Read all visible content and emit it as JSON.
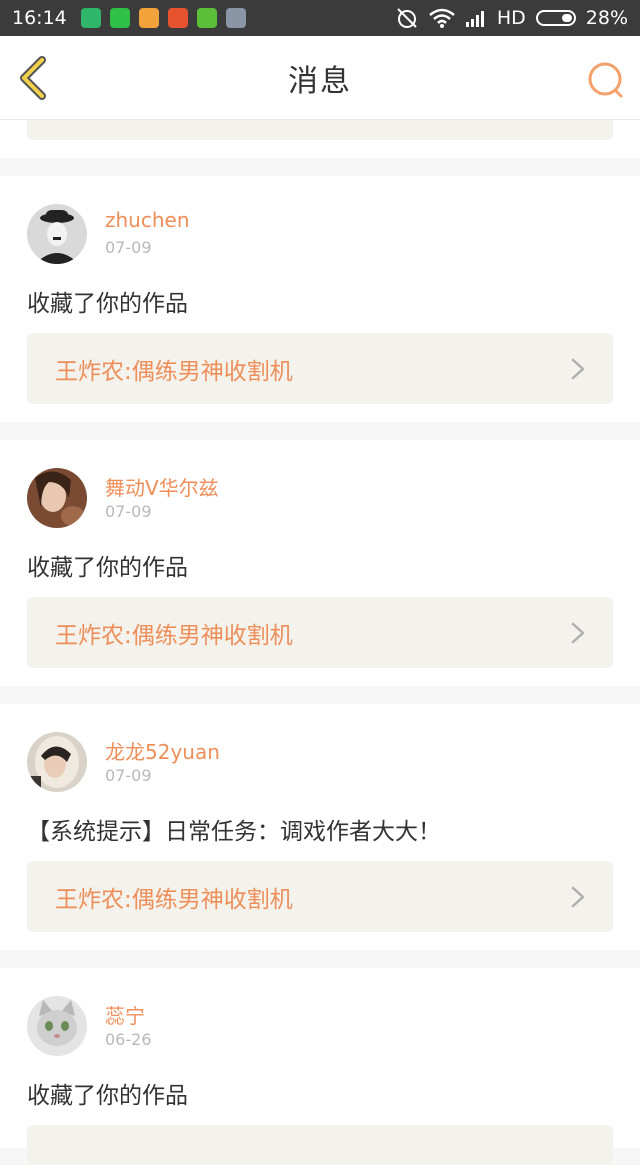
{
  "status_bar": {
    "time": "16:14",
    "network": "HD",
    "battery": "28%",
    "app_icons": [
      {
        "name": "shield-app-icon",
        "color": "#2fb66b"
      },
      {
        "name": "wechat-app-icon",
        "color": "#2fc04a"
      },
      {
        "name": "weibo-app-icon",
        "color": "#f2a23a"
      },
      {
        "name": "tv-app-icon",
        "color": "#e6522d"
      },
      {
        "name": "android-app-icon",
        "color": "#5bbf3a"
      },
      {
        "name": "notes-app-icon",
        "color": "#8a96a6"
      }
    ]
  },
  "header": {
    "title": "消息",
    "accent": "#f3a06a"
  },
  "messages": [
    {
      "username": "zhuchen",
      "date": "07-09",
      "text": "收藏了你的作品",
      "work": "王炸农:偶练男神收割机",
      "avatar": "chaplin-avatar"
    },
    {
      "username": "舞动V华尔兹",
      "date": "07-09",
      "text": "收藏了你的作品",
      "work": "王炸农:偶练男神收割机",
      "avatar": "girl-avatar"
    },
    {
      "username": "龙龙52yuan",
      "date": "07-09",
      "text": "【系统提示】日常任务：调戏作者大大！",
      "work": "王炸农:偶练男神收割机",
      "avatar": "hooded-avatar"
    },
    {
      "username": "蕊宁",
      "date": "06-26",
      "text": "收藏了你的作品",
      "avatar": "cat-avatar"
    }
  ]
}
